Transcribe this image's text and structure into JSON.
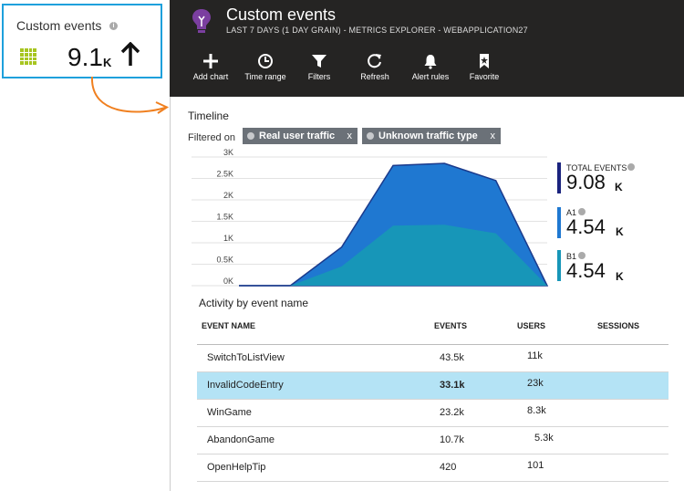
{
  "tile": {
    "title": "Custom events",
    "value": "9.1",
    "unit": "K",
    "trend": "up-arrow-icon"
  },
  "blade": {
    "title": "Custom events",
    "subtitle": "LAST 7 DAYS (1 DAY GRAIN) - METRICS EXPLORER - WEBAPPLICATION27",
    "icon": "lightbulb-icon",
    "toolbar": [
      {
        "label": "Add chart",
        "icon": "plus-icon"
      },
      {
        "label": "Time range",
        "icon": "clock-icon"
      },
      {
        "label": "Filters",
        "icon": "filter-icon"
      },
      {
        "label": "Refresh",
        "icon": "refresh-icon"
      },
      {
        "label": "Alert rules",
        "icon": "bell-icon"
      },
      {
        "label": "Favorite",
        "icon": "bookmark-icon"
      }
    ]
  },
  "timeline": {
    "title": "Timeline",
    "filtered_label": "Filtered on",
    "filters": [
      {
        "label": "Real user traffic",
        "remove": "x"
      },
      {
        "label": "Unknown traffic type",
        "remove": "x"
      }
    ],
    "legend": [
      {
        "label": "TOTAL EVENTS",
        "value": "9.08",
        "unit": "K",
        "color": "#1a237e"
      },
      {
        "label": "A1",
        "value": "4.54",
        "unit": "K",
        "color": "#1f78d1"
      },
      {
        "label": "B1",
        "value": "4.54",
        "unit": "K",
        "color": "#1796b8"
      }
    ]
  },
  "chart_data": {
    "type": "area",
    "x": [
      0,
      1,
      2,
      3,
      4,
      5,
      6
    ],
    "ylim": [
      0,
      3000
    ],
    "yticks": [
      "3K",
      "2.5K",
      "2K",
      "1.5K",
      "1K",
      "0.5K",
      "0K"
    ],
    "grid": true,
    "series": [
      {
        "name": "TOTAL EVENTS",
        "values": [
          0,
          0,
          900,
          2800,
          2850,
          2450,
          0
        ],
        "color": "#1f78d1",
        "line": "#1a3a8c"
      },
      {
        "name": "B1",
        "values": [
          0,
          0,
          450,
          1400,
          1420,
          1220,
          0
        ],
        "color": "#1796b8"
      }
    ]
  },
  "activity": {
    "title": "Activity by event name",
    "columns": [
      "EVENT NAME",
      "EVENTS",
      "USERS",
      "SESSIONS"
    ],
    "rows": [
      {
        "name": "SwitchToListView",
        "events": "43.5k",
        "users": "11k",
        "sessions": ""
      },
      {
        "name": "InvalidCodeEntry",
        "events": "33.1k",
        "users": "23k",
        "sessions": "",
        "selected": true
      },
      {
        "name": "WinGame",
        "events": "23.2k",
        "users": "8.3k",
        "sessions": ""
      },
      {
        "name": "AbandonGame",
        "events": "10.7k",
        "users": "5.3k",
        "sessions": ""
      },
      {
        "name": "OpenHelpTip",
        "events": "420",
        "users": "101",
        "sessions": ""
      }
    ]
  },
  "colors": {
    "tile_border": "#1ea0dc",
    "header_bg": "#252423",
    "selected_row": "#b4e3f5",
    "connector": "#f08020",
    "tile_icon": "#a7c520"
  }
}
